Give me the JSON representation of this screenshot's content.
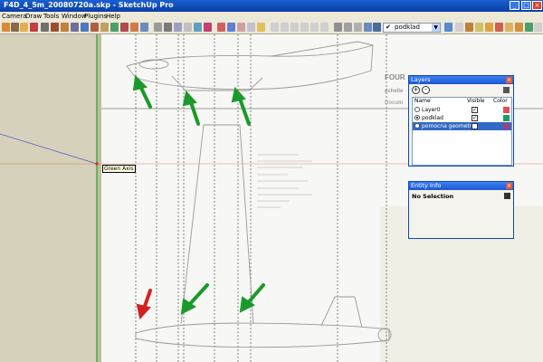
{
  "window": {
    "title": "F4D_4_5m_20080720a.skp - SketchUp Pro"
  },
  "menu": {
    "items": [
      "Camera",
      "Draw",
      "Tools",
      "Window",
      "Plugins",
      "Help"
    ]
  },
  "toolbar": {
    "layer_selector_value": "podklad"
  },
  "layers_panel": {
    "title": "Layers",
    "add_symbol": "+",
    "remove_symbol": "-",
    "col_name": "Name",
    "col_visible": "Visible",
    "col_color": "Color",
    "rows": [
      {
        "name": "Layer0",
        "active": false,
        "visible": true,
        "color": "#e05050",
        "selected": false
      },
      {
        "name": "podklad",
        "active": true,
        "visible": true,
        "color": "#1c9a6a",
        "selected": false
      },
      {
        "name": "pomocna geometrie",
        "active": false,
        "visible": false,
        "color": "#a04080",
        "selected": true
      }
    ]
  },
  "entity_panel": {
    "title": "Entity Info",
    "status": "No Selection"
  },
  "canvas": {
    "tooltip": "Green Axis",
    "bg_title": "FOUR",
    "bg_subtitle": "échelle",
    "bg_doc": "Docum",
    "arrow_green": "#1a9a2a",
    "arrow_red": "#d42020",
    "axis_red": "#e05030",
    "axis_green": "#30b030"
  }
}
